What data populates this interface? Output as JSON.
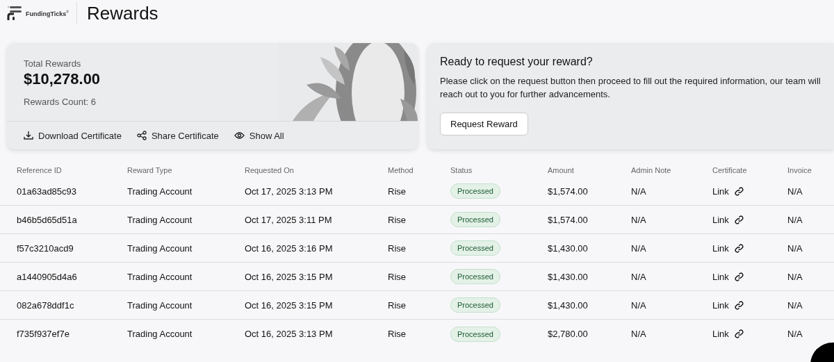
{
  "header": {
    "brand": "FundingTicks",
    "brand_mark": "®",
    "title": "Rewards"
  },
  "summary": {
    "label": "Total Rewards",
    "total": "$10,278.00",
    "count": "Rewards Count: 6",
    "actions": [
      {
        "label": "Download Certificate",
        "kind": "download"
      },
      {
        "label": "Share Certificate",
        "kind": "share"
      },
      {
        "label": "Show All",
        "kind": "view"
      }
    ]
  },
  "request": {
    "title": "Ready to request your reward?",
    "text": "Please click on the request button then proceed to fill out the required information, our team will reach out to you for further advancements.",
    "button": "Request Reward"
  },
  "table": {
    "columns": [
      "Reference ID",
      "Reward Type",
      "Requested On",
      "Method",
      "Status",
      "Amount",
      "Admin Note",
      "Certificate",
      "Invoice"
    ],
    "rows": [
      {
        "id": "01a63ad85c93",
        "type": "Trading Account",
        "date": "Oct 17, 2025 3:13 PM",
        "method": "Rise",
        "status": "Processed",
        "amount": "$1,574.00",
        "note": "N/A",
        "certificate": "Link",
        "invoice": "N/A"
      },
      {
        "id": "b46b5d65d51a",
        "type": "Trading Account",
        "date": "Oct 17, 2025 3:11 PM",
        "method": "Rise",
        "status": "Processed",
        "amount": "$1,574.00",
        "note": "N/A",
        "certificate": "Link",
        "invoice": "N/A"
      },
      {
        "id": "f57c3210acd9",
        "type": "Trading Account",
        "date": "Oct 16, 2025 3:16 PM",
        "method": "Rise",
        "status": "Processed",
        "amount": "$1,430.00",
        "note": "N/A",
        "certificate": "Link",
        "invoice": "N/A"
      },
      {
        "id": "a1440905d4a6",
        "type": "Trading Account",
        "date": "Oct 16, 2025 3:15 PM",
        "method": "Rise",
        "status": "Processed",
        "amount": "$1,430.00",
        "note": "N/A",
        "certificate": "Link",
        "invoice": "N/A"
      },
      {
        "id": "082a678ddf1c",
        "type": "Trading Account",
        "date": "Oct 16, 2025 3:15 PM",
        "method": "Rise",
        "status": "Processed",
        "amount": "$1,430.00",
        "note": "N/A",
        "certificate": "Link",
        "invoice": "N/A"
      },
      {
        "id": "f735f937ef7e",
        "type": "Trading Account",
        "date": "Oct 16, 2025 3:13 PM",
        "method": "Rise",
        "status": "Processed",
        "amount": "$2,780.00",
        "note": "N/A",
        "certificate": "Link",
        "invoice": "N/A"
      }
    ]
  }
}
